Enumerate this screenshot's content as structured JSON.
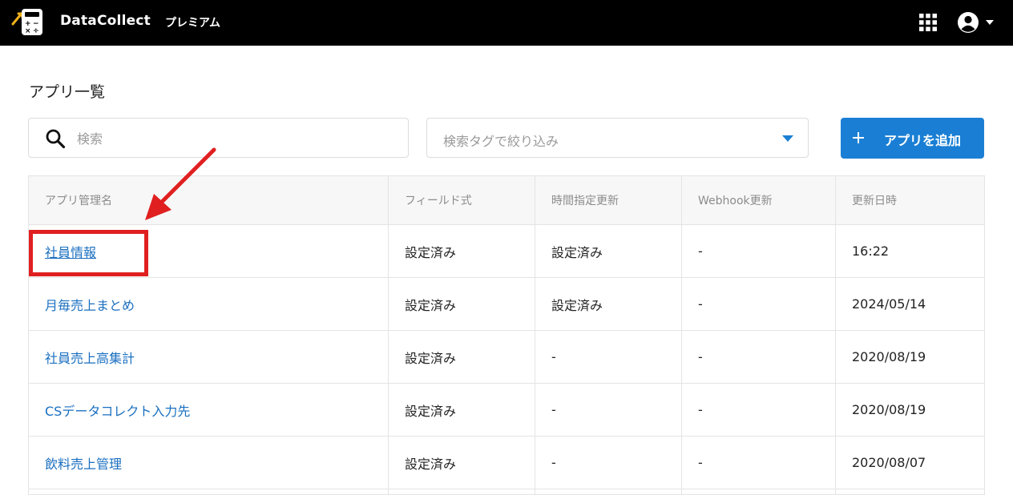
{
  "header": {
    "brand": "DataCollect",
    "plan": "プレミアム",
    "icons": {
      "logo": "calculator-logo-icon",
      "apps": "grid-apps-icon",
      "account": "account-circle-icon",
      "account_menu": "caret-down-icon"
    }
  },
  "page": {
    "title": "アプリ一覧"
  },
  "toolbar": {
    "search_placeholder": "検索",
    "search_value": "",
    "tag_filter_placeholder": "検索タグで絞り込み",
    "add_button_label": "アプリを追加"
  },
  "table": {
    "columns": [
      "アプリ管理名",
      "フィールド式",
      "時間指定更新",
      "Webhook更新",
      "更新日時"
    ],
    "rows": [
      {
        "name": "社員情報",
        "field_formula": "設定済み",
        "scheduled_update": "設定済み",
        "webhook_update": "-",
        "updated_at": "16:22"
      },
      {
        "name": "月毎売上まとめ",
        "field_formula": "設定済み",
        "scheduled_update": "設定済み",
        "webhook_update": "-",
        "updated_at": "2024/05/14"
      },
      {
        "name": "社員売上高集計",
        "field_formula": "設定済み",
        "scheduled_update": "-",
        "webhook_update": "-",
        "updated_at": "2020/08/19"
      },
      {
        "name": "CSデータコレクト入力先",
        "field_formula": "設定済み",
        "scheduled_update": "-",
        "webhook_update": "-",
        "updated_at": "2020/08/19"
      },
      {
        "name": "飲料売上管理",
        "field_formula": "設定済み",
        "scheduled_update": "-",
        "webhook_update": "-",
        "updated_at": "2020/08/07"
      }
    ]
  },
  "colors": {
    "header_bg": "#000000",
    "accent": "#1a7fd4",
    "link": "#1a6fc0",
    "annotation": "#e02020"
  }
}
